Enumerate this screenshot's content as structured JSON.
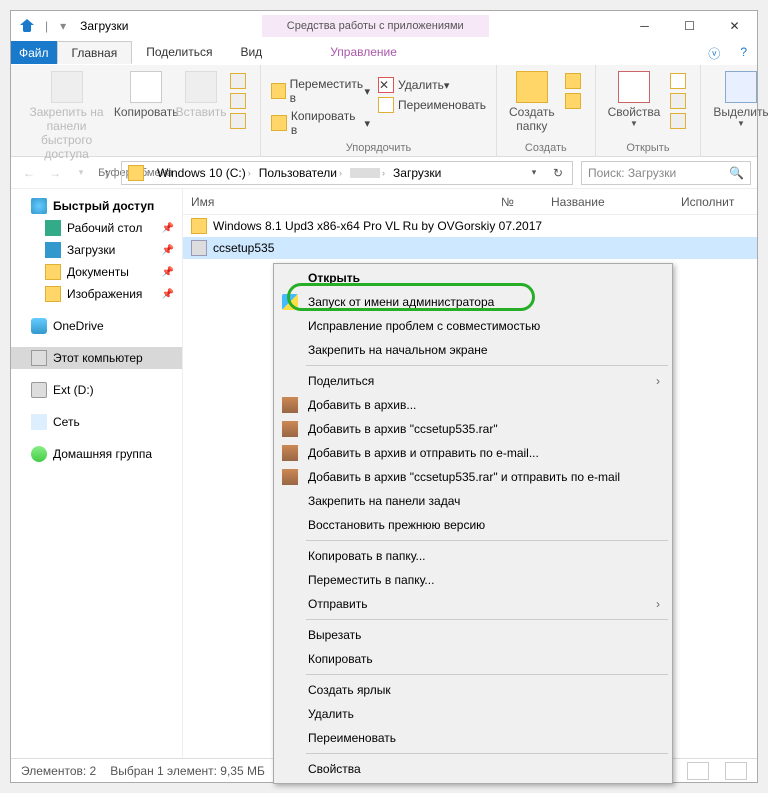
{
  "title": "Загрузки",
  "tooltab": "Средства работы с приложениями",
  "tabs": {
    "file": "Файл",
    "home": "Главная",
    "share": "Поделиться",
    "view": "Вид",
    "manage": "Управление"
  },
  "ribbon": {
    "pin": "Закрепить на панели\nбыстрого доступа",
    "copy": "Копировать",
    "paste": "Вставить",
    "clipboard": "Буфер обмена",
    "moveto": "Переместить в",
    "copyto": "Копировать в",
    "delete": "Удалить",
    "rename": "Переименовать",
    "organize": "Упорядочить",
    "newfolder": "Создать\nпапку",
    "create": "Создать",
    "props": "Свойства",
    "open": "Открыть",
    "select": "Выделить"
  },
  "breadcrumb": [
    "Windows 10 (C:)",
    "Пользователи",
    "",
    "Загрузки"
  ],
  "search_placeholder": "Поиск: Загрузки",
  "cols": {
    "name": "Имя",
    "num": "№",
    "title": "Название",
    "exec": "Исполнит"
  },
  "nav": {
    "quick": "Быстрый доступ",
    "desktop": "Рабочий стол",
    "downloads": "Загрузки",
    "documents": "Документы",
    "pictures": "Изображения",
    "onedrive": "OneDrive",
    "thispc": "Этот компьютер",
    "ext": "Ext (D:)",
    "network": "Сеть",
    "homegroup": "Домашняя группа"
  },
  "files": [
    {
      "name": "Windows 8.1 Upd3 x86-x64 Pro VL Ru by OVGorskiy 07.2017",
      "type": "folder"
    },
    {
      "name": "ccsetup535",
      "type": "exe"
    }
  ],
  "ctx": {
    "open": "Открыть",
    "runas": "Запуск от имени администратора",
    "compat": "Исправление проблем с совместимостью",
    "start": "Закрепить на начальном экране",
    "share": "Поделиться",
    "addarch": "Добавить в архив...",
    "addrar": "Добавить в архив \"ccsetup535.rar\"",
    "addmail": "Добавить в архив и отправить по e-mail...",
    "addrarmail": "Добавить в архив \"ccsetup535.rar\" и отправить по e-mail",
    "taskbar": "Закрепить на панели задач",
    "restore": "Восстановить прежнюю версию",
    "copyto": "Копировать в папку...",
    "moveto": "Переместить в папку...",
    "sendto": "Отправить",
    "cut": "Вырезать",
    "copy": "Копировать",
    "shortcut": "Создать ярлык",
    "delete": "Удалить",
    "rename": "Переименовать",
    "props": "Свойства"
  },
  "status": {
    "elements": "Элементов: 2",
    "selected": "Выбран 1 элемент: 9,35 МБ"
  }
}
